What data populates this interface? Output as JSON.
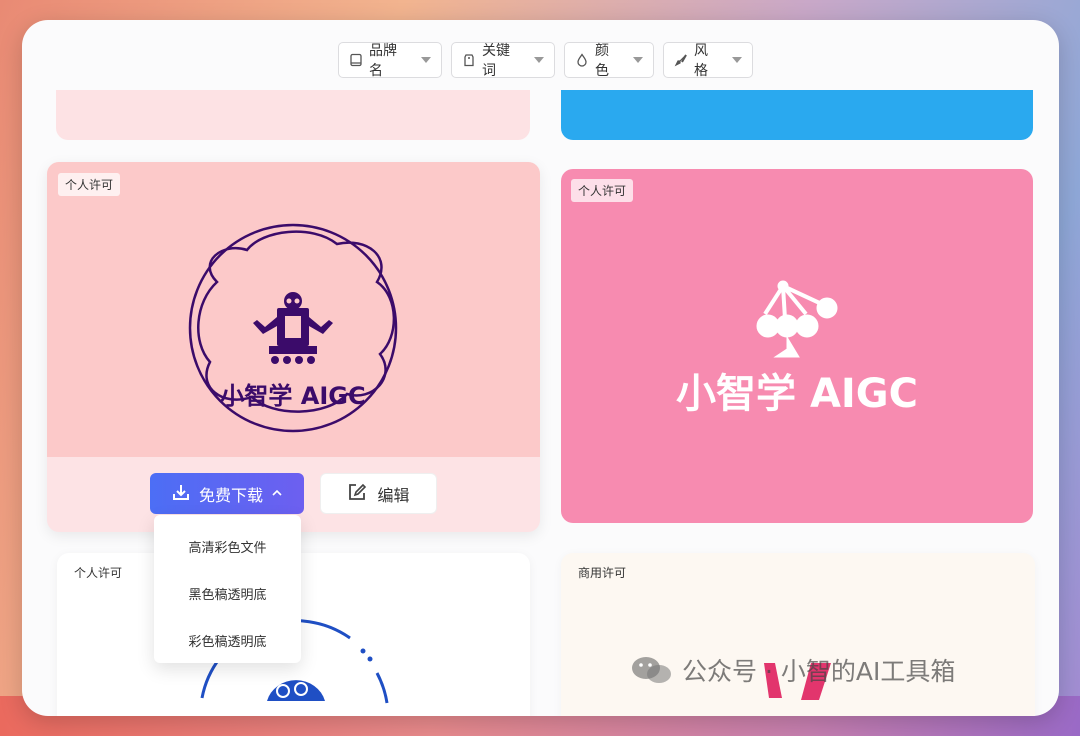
{
  "filters": [
    {
      "label": "品牌名",
      "icon": "book-icon"
    },
    {
      "label": "关键词",
      "icon": "tag-icon"
    },
    {
      "label": "颜色",
      "icon": "drop-icon"
    },
    {
      "label": "风格",
      "icon": "brush-icon"
    }
  ],
  "cards": {
    "main": {
      "badge": "个人许可",
      "logo_text": "小智学 AIGC"
    },
    "pink": {
      "badge": "个人许可",
      "logo_text": "小智学 AIGC"
    },
    "bottom_left": {
      "badge": "个人许可"
    },
    "bottom_right": {
      "badge": "商用许可"
    }
  },
  "actions": {
    "download_label": "免费下载",
    "edit_label": "编辑"
  },
  "download_menu": [
    "高清彩色文件",
    "黑色稿透明底",
    "彩色稿透明底"
  ],
  "watermark": {
    "text": "公众号 · 小智的AI工具箱"
  },
  "colors": {
    "accent": "#4c6ef5",
    "pink_card": "#f78bb0",
    "blue_card": "#2aa9ef",
    "logo_purple": "#3b0b6a"
  }
}
